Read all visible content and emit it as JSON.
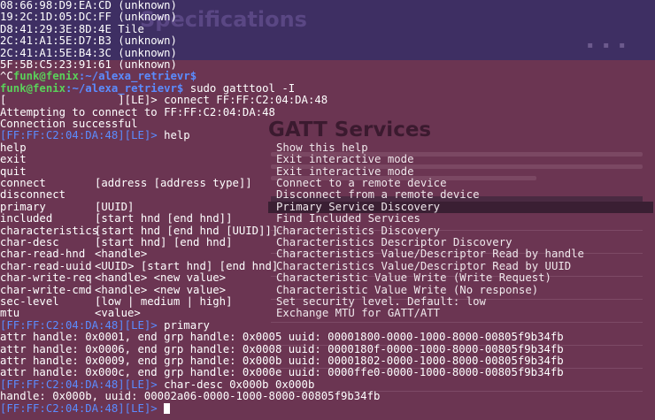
{
  "background_page": {
    "header_title": "Specifications",
    "page_title": "GATT Services"
  },
  "terminal": {
    "scan_results": [
      "08:66:98:D9:EA:CD (unknown)",
      "19:2C:1D:05:DC:FF (unknown)",
      "D8:41:29:3E:8D:4E Tile",
      "2C:41:A1:5E:D7:B3 (unknown)",
      "2C:41:A1:5E:B4:3C (unknown)",
      "5F:5B:C5:23:91:61 (unknown)"
    ],
    "shell_prompt_user": "funk@fenix",
    "shell_prompt_path": ":~/alexa_retrievr$",
    "ctrl_c": "^C",
    "command_gatttool": " sudo gatttool -I",
    "connect_line": "[                 ][LE]> connect FF:FF:C2:04:DA:48",
    "attempting": "Attempting to connect to FF:FF:C2:04:DA:48",
    "success": "Connection successful",
    "tool_prompt": "[FF:FF:C2:04:DA:48][LE]>",
    "cmd_help": " help",
    "help_commands": [
      {
        "cmd": "help",
        "args": "",
        "desc": "Show this help"
      },
      {
        "cmd": "exit",
        "args": "",
        "desc": "Exit interactive mode"
      },
      {
        "cmd": "quit",
        "args": "",
        "desc": "Exit interactive mode"
      },
      {
        "cmd": "connect",
        "args": "[address [address type]]",
        "desc": "Connect to a remote device"
      },
      {
        "cmd": "disconnect",
        "args": "",
        "desc": "Disconnect from a remote device"
      },
      {
        "cmd": "primary",
        "args": "[UUID]",
        "desc": "Primary Service Discovery"
      },
      {
        "cmd": "included",
        "args": "[start hnd [end hnd]]",
        "desc": "Find Included Services"
      },
      {
        "cmd": "characteristics",
        "args": "[start hnd [end hnd [UUID]]]",
        "desc": "Characteristics Discovery"
      },
      {
        "cmd": "char-desc",
        "args": "[start hnd] [end hnd]",
        "desc": "Characteristics Descriptor Discovery"
      },
      {
        "cmd": "char-read-hnd",
        "args": "<handle>",
        "desc": "Characteristics Value/Descriptor Read by handle"
      },
      {
        "cmd": "char-read-uuid",
        "args": "<UUID> [start hnd] [end hnd]",
        "desc": "Characteristics Value/Descriptor Read by UUID"
      },
      {
        "cmd": "char-write-req",
        "args": "<handle> <new value>",
        "desc": "Characteristic Value Write (Write Request)"
      },
      {
        "cmd": "char-write-cmd",
        "args": "<handle> <new value>",
        "desc": "Characteristic Value Write (No response)"
      },
      {
        "cmd": "sec-level",
        "args": "[low | medium | high]",
        "desc": "Set security level. Default: low"
      },
      {
        "cmd": "mtu",
        "args": "<value>",
        "desc": "Exchange MTU for GATT/ATT"
      }
    ],
    "cmd_primary": " primary",
    "primary_results": [
      "attr handle: 0x0001, end grp handle: 0x0005 uuid: 00001800-0000-1000-8000-00805f9b34fb",
      "attr handle: 0x0006, end grp handle: 0x0008 uuid: 0000180f-0000-1000-8000-00805f9b34fb",
      "attr handle: 0x0009, end grp handle: 0x000b uuid: 00001802-0000-1000-8000-00805f9b34fb",
      "attr handle: 0x000c, end grp handle: 0x000e uuid: 0000ffe0-0000-1000-8000-00805f9b34fb"
    ],
    "cmd_char_desc": " char-desc 0x000b 0x000b",
    "char_desc_result": "handle: 0x000b, uuid: 00002a06-0000-1000-8000-00805f9b34fb",
    "final_prompt_suffix": " "
  }
}
